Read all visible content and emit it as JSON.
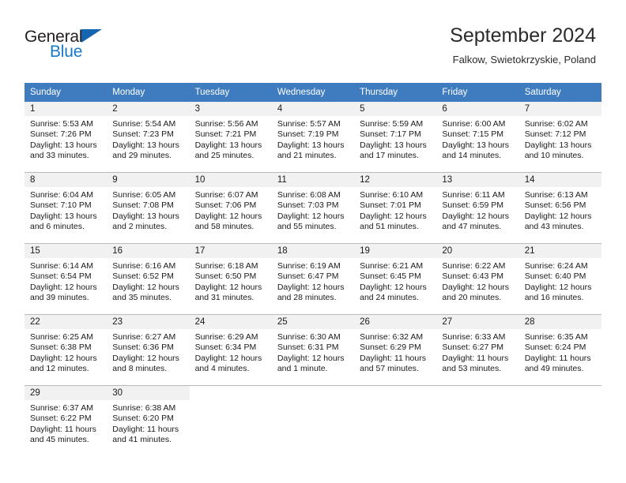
{
  "brand": {
    "word_one": "General",
    "word_two": "Blue",
    "triangle_icon": "triangle-icon",
    "accent_dark": "#231f20",
    "accent_blue": "#1579c8"
  },
  "header": {
    "title": "September 2024",
    "subtitle": "Falkow, Swietokrzyskie, Poland"
  },
  "theme": {
    "header_bg": "#3f7cbf",
    "header_text": "#ffffff",
    "day_band_bg": "#f1f1f1",
    "grid_line": "#b9b9b9",
    "text": "#1a1a1a"
  },
  "calendar": {
    "weekday_headers": [
      "Sunday",
      "Monday",
      "Tuesday",
      "Wednesday",
      "Thursday",
      "Friday",
      "Saturday"
    ],
    "weeks": [
      [
        {
          "day": "1",
          "lines": [
            "Sunrise: 5:53 AM",
            "Sunset: 7:26 PM",
            "Daylight: 13 hours",
            "and 33 minutes."
          ],
          "sunrise": "5:53 AM",
          "sunset": "7:26 PM",
          "daylight": "13 hours and 33 minutes."
        },
        {
          "day": "2",
          "lines": [
            "Sunrise: 5:54 AM",
            "Sunset: 7:23 PM",
            "Daylight: 13 hours",
            "and 29 minutes."
          ],
          "sunrise": "5:54 AM",
          "sunset": "7:23 PM",
          "daylight": "13 hours and 29 minutes."
        },
        {
          "day": "3",
          "lines": [
            "Sunrise: 5:56 AM",
            "Sunset: 7:21 PM",
            "Daylight: 13 hours",
            "and 25 minutes."
          ],
          "sunrise": "5:56 AM",
          "sunset": "7:21 PM",
          "daylight": "13 hours and 25 minutes."
        },
        {
          "day": "4",
          "lines": [
            "Sunrise: 5:57 AM",
            "Sunset: 7:19 PM",
            "Daylight: 13 hours",
            "and 21 minutes."
          ],
          "sunrise": "5:57 AM",
          "sunset": "7:19 PM",
          "daylight": "13 hours and 21 minutes."
        },
        {
          "day": "5",
          "lines": [
            "Sunrise: 5:59 AM",
            "Sunset: 7:17 PM",
            "Daylight: 13 hours",
            "and 17 minutes."
          ],
          "sunrise": "5:59 AM",
          "sunset": "7:17 PM",
          "daylight": "13 hours and 17 minutes."
        },
        {
          "day": "6",
          "lines": [
            "Sunrise: 6:00 AM",
            "Sunset: 7:15 PM",
            "Daylight: 13 hours",
            "and 14 minutes."
          ],
          "sunrise": "6:00 AM",
          "sunset": "7:15 PM",
          "daylight": "13 hours and 14 minutes."
        },
        {
          "day": "7",
          "lines": [
            "Sunrise: 6:02 AM",
            "Sunset: 7:12 PM",
            "Daylight: 13 hours",
            "and 10 minutes."
          ],
          "sunrise": "6:02 AM",
          "sunset": "7:12 PM",
          "daylight": "13 hours and 10 minutes."
        }
      ],
      [
        {
          "day": "8",
          "lines": [
            "Sunrise: 6:04 AM",
            "Sunset: 7:10 PM",
            "Daylight: 13 hours",
            "and 6 minutes."
          ],
          "sunrise": "6:04 AM",
          "sunset": "7:10 PM",
          "daylight": "13 hours and 6 minutes."
        },
        {
          "day": "9",
          "lines": [
            "Sunrise: 6:05 AM",
            "Sunset: 7:08 PM",
            "Daylight: 13 hours",
            "and 2 minutes."
          ],
          "sunrise": "6:05 AM",
          "sunset": "7:08 PM",
          "daylight": "13 hours and 2 minutes."
        },
        {
          "day": "10",
          "lines": [
            "Sunrise: 6:07 AM",
            "Sunset: 7:06 PM",
            "Daylight: 12 hours",
            "and 58 minutes."
          ],
          "sunrise": "6:07 AM",
          "sunset": "7:06 PM",
          "daylight": "12 hours and 58 minutes."
        },
        {
          "day": "11",
          "lines": [
            "Sunrise: 6:08 AM",
            "Sunset: 7:03 PM",
            "Daylight: 12 hours",
            "and 55 minutes."
          ],
          "sunrise": "6:08 AM",
          "sunset": "7:03 PM",
          "daylight": "12 hours and 55 minutes."
        },
        {
          "day": "12",
          "lines": [
            "Sunrise: 6:10 AM",
            "Sunset: 7:01 PM",
            "Daylight: 12 hours",
            "and 51 minutes."
          ],
          "sunrise": "6:10 AM",
          "sunset": "7:01 PM",
          "daylight": "12 hours and 51 minutes."
        },
        {
          "day": "13",
          "lines": [
            "Sunrise: 6:11 AM",
            "Sunset: 6:59 PM",
            "Daylight: 12 hours",
            "and 47 minutes."
          ],
          "sunrise": "6:11 AM",
          "sunset": "6:59 PM",
          "daylight": "12 hours and 47 minutes."
        },
        {
          "day": "14",
          "lines": [
            "Sunrise: 6:13 AM",
            "Sunset: 6:56 PM",
            "Daylight: 12 hours",
            "and 43 minutes."
          ],
          "sunrise": "6:13 AM",
          "sunset": "6:56 PM",
          "daylight": "12 hours and 43 minutes."
        }
      ],
      [
        {
          "day": "15",
          "lines": [
            "Sunrise: 6:14 AM",
            "Sunset: 6:54 PM",
            "Daylight: 12 hours",
            "and 39 minutes."
          ],
          "sunrise": "6:14 AM",
          "sunset": "6:54 PM",
          "daylight": "12 hours and 39 minutes."
        },
        {
          "day": "16",
          "lines": [
            "Sunrise: 6:16 AM",
            "Sunset: 6:52 PM",
            "Daylight: 12 hours",
            "and 35 minutes."
          ],
          "sunrise": "6:16 AM",
          "sunset": "6:52 PM",
          "daylight": "12 hours and 35 minutes."
        },
        {
          "day": "17",
          "lines": [
            "Sunrise: 6:18 AM",
            "Sunset: 6:50 PM",
            "Daylight: 12 hours",
            "and 31 minutes."
          ],
          "sunrise": "6:18 AM",
          "sunset": "6:50 PM",
          "daylight": "12 hours and 31 minutes."
        },
        {
          "day": "18",
          "lines": [
            "Sunrise: 6:19 AM",
            "Sunset: 6:47 PM",
            "Daylight: 12 hours",
            "and 28 minutes."
          ],
          "sunrise": "6:19 AM",
          "sunset": "6:47 PM",
          "daylight": "12 hours and 28 minutes."
        },
        {
          "day": "19",
          "lines": [
            "Sunrise: 6:21 AM",
            "Sunset: 6:45 PM",
            "Daylight: 12 hours",
            "and 24 minutes."
          ],
          "sunrise": "6:21 AM",
          "sunset": "6:45 PM",
          "daylight": "12 hours and 24 minutes."
        },
        {
          "day": "20",
          "lines": [
            "Sunrise: 6:22 AM",
            "Sunset: 6:43 PM",
            "Daylight: 12 hours",
            "and 20 minutes."
          ],
          "sunrise": "6:22 AM",
          "sunset": "6:43 PM",
          "daylight": "12 hours and 20 minutes."
        },
        {
          "day": "21",
          "lines": [
            "Sunrise: 6:24 AM",
            "Sunset: 6:40 PM",
            "Daylight: 12 hours",
            "and 16 minutes."
          ],
          "sunrise": "6:24 AM",
          "sunset": "6:40 PM",
          "daylight": "12 hours and 16 minutes."
        }
      ],
      [
        {
          "day": "22",
          "lines": [
            "Sunrise: 6:25 AM",
            "Sunset: 6:38 PM",
            "Daylight: 12 hours",
            "and 12 minutes."
          ],
          "sunrise": "6:25 AM",
          "sunset": "6:38 PM",
          "daylight": "12 hours and 12 minutes."
        },
        {
          "day": "23",
          "lines": [
            "Sunrise: 6:27 AM",
            "Sunset: 6:36 PM",
            "Daylight: 12 hours",
            "and 8 minutes."
          ],
          "sunrise": "6:27 AM",
          "sunset": "6:36 PM",
          "daylight": "12 hours and 8 minutes."
        },
        {
          "day": "24",
          "lines": [
            "Sunrise: 6:29 AM",
            "Sunset: 6:34 PM",
            "Daylight: 12 hours",
            "and 4 minutes."
          ],
          "sunrise": "6:29 AM",
          "sunset": "6:34 PM",
          "daylight": "12 hours and 4 minutes."
        },
        {
          "day": "25",
          "lines": [
            "Sunrise: 6:30 AM",
            "Sunset: 6:31 PM",
            "Daylight: 12 hours",
            "and 1 minute."
          ],
          "sunrise": "6:30 AM",
          "sunset": "6:31 PM",
          "daylight": "12 hours and 1 minute."
        },
        {
          "day": "26",
          "lines": [
            "Sunrise: 6:32 AM",
            "Sunset: 6:29 PM",
            "Daylight: 11 hours",
            "and 57 minutes."
          ],
          "sunrise": "6:32 AM",
          "sunset": "6:29 PM",
          "daylight": "11 hours and 57 minutes."
        },
        {
          "day": "27",
          "lines": [
            "Sunrise: 6:33 AM",
            "Sunset: 6:27 PM",
            "Daylight: 11 hours",
            "and 53 minutes."
          ],
          "sunrise": "6:33 AM",
          "sunset": "6:27 PM",
          "daylight": "11 hours and 53 minutes."
        },
        {
          "day": "28",
          "lines": [
            "Sunrise: 6:35 AM",
            "Sunset: 6:24 PM",
            "Daylight: 11 hours",
            "and 49 minutes."
          ],
          "sunrise": "6:35 AM",
          "sunset": "6:24 PM",
          "daylight": "11 hours and 49 minutes."
        }
      ],
      [
        {
          "day": "29",
          "lines": [
            "Sunrise: 6:37 AM",
            "Sunset: 6:22 PM",
            "Daylight: 11 hours",
            "and 45 minutes."
          ],
          "sunrise": "6:37 AM",
          "sunset": "6:22 PM",
          "daylight": "11 hours and 45 minutes."
        },
        {
          "day": "30",
          "lines": [
            "Sunrise: 6:38 AM",
            "Sunset: 6:20 PM",
            "Daylight: 11 hours",
            "and 41 minutes."
          ],
          "sunrise": "6:38 AM",
          "sunset": "6:20 PM",
          "daylight": "11 hours and 41 minutes."
        },
        {
          "day": "",
          "lines": []
        },
        {
          "day": "",
          "lines": []
        },
        {
          "day": "",
          "lines": []
        },
        {
          "day": "",
          "lines": []
        },
        {
          "day": "",
          "lines": []
        }
      ]
    ]
  }
}
